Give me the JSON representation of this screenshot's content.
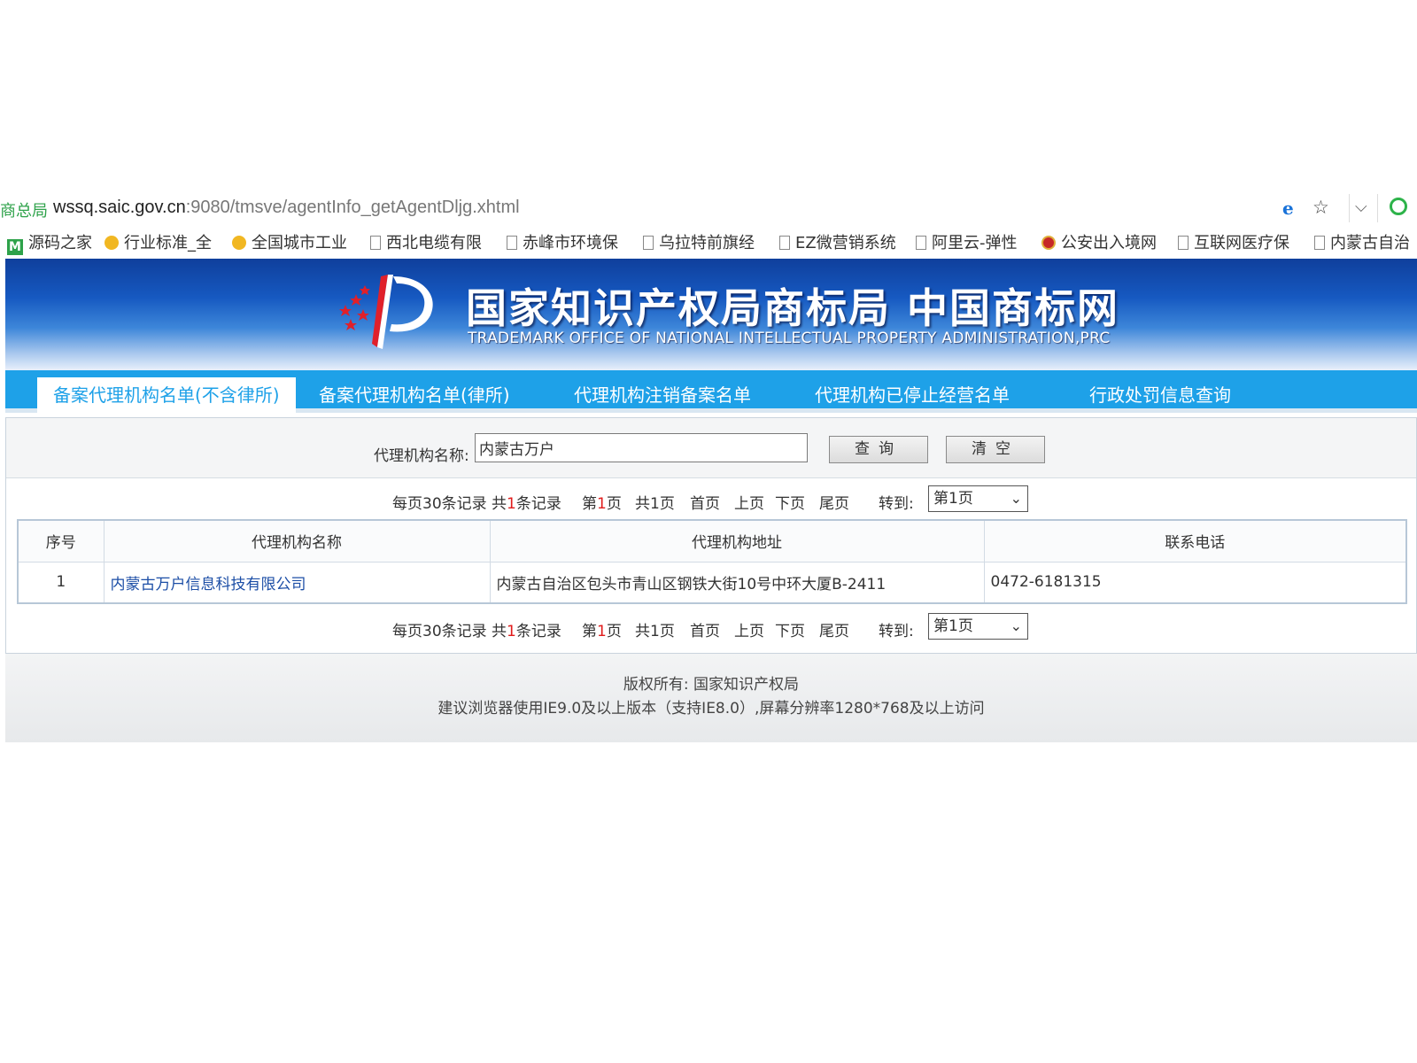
{
  "browser": {
    "site_fragment": "商总局",
    "url_host": "wssq.saic.gov.cn",
    "url_path": ":9080/tmsve/agentInfo_getAgentDljg.xhtml",
    "bookmarks": [
      {
        "label": "源码之家",
        "icon": "m-icon"
      },
      {
        "label": "行业标准_全",
        "icon": "coin-icon"
      },
      {
        "label": "全国城市工业",
        "icon": "coin-icon"
      },
      {
        "label": "西北电缆有限",
        "icon": "page-icon"
      },
      {
        "label": "赤峰市环境保",
        "icon": "page-icon"
      },
      {
        "label": "乌拉特前旗经",
        "icon": "page-icon"
      },
      {
        "label": "EZ微营销系统",
        "icon": "page-icon"
      },
      {
        "label": "阿里云-弹性",
        "icon": "page-icon"
      },
      {
        "label": "公安出入境网",
        "icon": "police-icon"
      },
      {
        "label": "互联网医疗保",
        "icon": "page-icon"
      },
      {
        "label": "内蒙古自治",
        "icon": "page-icon"
      }
    ]
  },
  "header": {
    "title": "国家知识产权局商标局 中国商标网",
    "subtitle": "TRADEMARK OFFICE OF NATIONAL INTELLECTUAL PROPERTY ADMINISTRATION,PRC"
  },
  "tabs": [
    {
      "label": "备案代理机构名单(不含律所)",
      "active": true
    },
    {
      "label": "备案代理机构名单(律所)",
      "active": false
    },
    {
      "label": "代理机构注销备案名单",
      "active": false
    },
    {
      "label": "代理机构已停止经营名单",
      "active": false
    },
    {
      "label": "行政处罚信息查询",
      "active": false
    }
  ],
  "search": {
    "label": "代理机构名称:",
    "value": "内蒙古万户",
    "query_button": "查询",
    "clear_button": "清空"
  },
  "pager": {
    "per_page_prefix": "每页30条记录 共",
    "total": "1",
    "total_suffix": "条记录",
    "page_prefix": "第",
    "page": "1",
    "page_suffix": "页",
    "total_pages": "共1页",
    "first": "首页",
    "prev": "上页",
    "next": "下页",
    "last": "尾页",
    "goto": "转到:",
    "goto_value": "第1页"
  },
  "table": {
    "columns": [
      "序号",
      "代理机构名称",
      "代理机构地址",
      "联系电话"
    ],
    "rows": [
      {
        "no": "1",
        "name": "内蒙古万户信息科技有限公司",
        "address": "内蒙古自治区包头市青山区钢铁大街10号中环大厦B-2411",
        "phone": "0472-6181315"
      }
    ]
  },
  "footer": {
    "copyright": "版权所有: 国家知识产权局",
    "notice": "建议浏览器使用IE9.0及以上版本（支持IE8.0）,屏幕分辨率1280*768及以上访问"
  },
  "colors": {
    "tab_bar": "#1ea1e8",
    "link": "#1c4ea6",
    "highlight_red": "#e01b1b"
  }
}
